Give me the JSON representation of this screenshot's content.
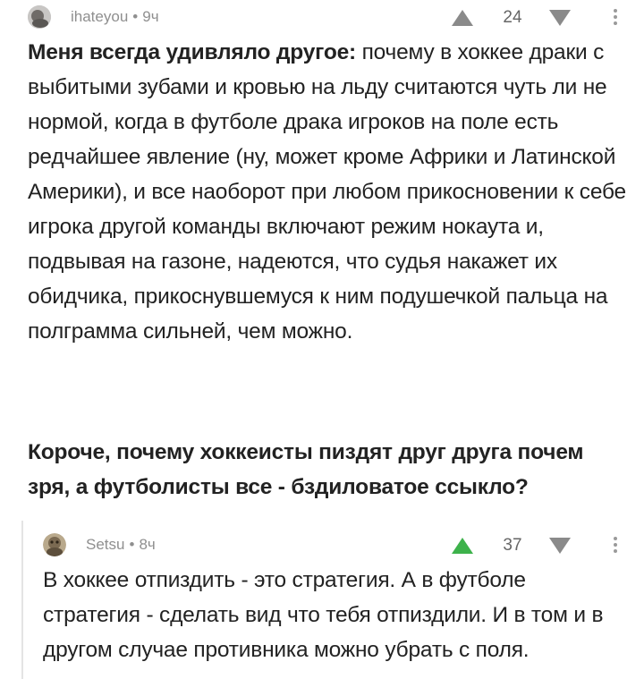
{
  "comment": {
    "author": "ihateyou",
    "separator": "•",
    "time": "9ч",
    "rating": "24",
    "lead_bold": "Меня всегда удивляло другое:",
    "text": " почему в хоккее драки с выбитыми зубами и кровью на льду считаются чуть ли не нормой, когда в футболе драка игроков на поле есть редчайшее явление (ну, может кроме Африки и Латинской Америки), и все наоборот при любом прикосновении к себе игрока другой команды включают режим нокаута и, подвывая на газоне, надеются, что судья накажет их обидчика, прикоснувшемуся к ним подушечкой пальца на полграмма сильней, чем можно.",
    "conclusion_bold": "Короче, почему хоккеисты пиздят друг друга почем зря, а футболисты все - бздиловатое ссыкло?"
  },
  "reply": {
    "author": "Setsu",
    "separator": "•",
    "time": "8ч",
    "rating": "37",
    "text": "В хоккее отпиздить - это стратегия. А в футболе стратегия - сделать вид что тебя отпиздили. И в том и в другом случае противника можно убрать с поля."
  },
  "colors": {
    "upvote_active": "#3db24b",
    "vote_inactive": "#8a8a8a",
    "meta_text": "#8f8f8f"
  }
}
